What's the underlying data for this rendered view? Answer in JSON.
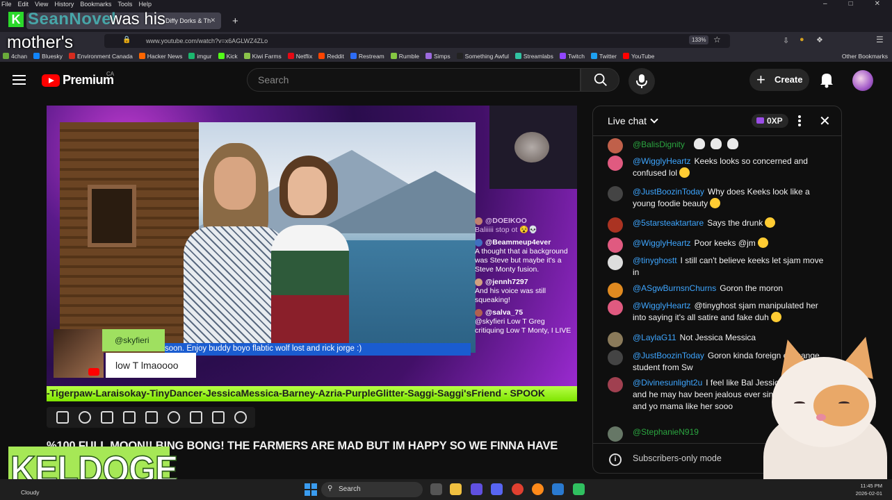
{
  "browser": {
    "menu": [
      "File",
      "Edit",
      "View",
      "History",
      "Bookmarks",
      "Tools",
      "Help"
    ],
    "tab_title": "Diffy Dorks & Th",
    "url": "www.youtube.com/watch?v=x6AGLWZ4ZLo",
    "zoom": "133%",
    "bookmarks": [
      {
        "label": "4chan",
        "color": "#6aaa3a"
      },
      {
        "label": "Bluesky",
        "color": "#1185fe"
      },
      {
        "label": "Environment Canada",
        "color": "#d52b1e"
      },
      {
        "label": "Hacker News",
        "color": "#ff6600"
      },
      {
        "label": "imgur",
        "color": "#1bb76e"
      },
      {
        "label": "Kick",
        "color": "#53fc18"
      },
      {
        "label": "Kiwi Farms",
        "color": "#8bc34a"
      },
      {
        "label": "Netflix",
        "color": "#e50914"
      },
      {
        "label": "Reddit",
        "color": "#ff4500"
      },
      {
        "label": "Restream",
        "color": "#2d6df6"
      },
      {
        "label": "Rumble",
        "color": "#85c742"
      },
      {
        "label": "Simps",
        "color": "#9c6ade"
      },
      {
        "label": "Something Awful",
        "color": "#222222"
      },
      {
        "label": "Streamlabs",
        "color": "#31c3a2"
      },
      {
        "label": "Twitch",
        "color": "#9146ff"
      },
      {
        "label": "Twitter",
        "color": "#1da1f2"
      },
      {
        "label": "YouTube",
        "color": "#ff0000"
      }
    ],
    "other_bookmarks": "Other Bookmarks"
  },
  "overlay": {
    "k_badge": "K",
    "name": "SeanNovel",
    "line1": "was his",
    "line2": "mother's",
    "brand": "KELDOGE"
  },
  "youtube": {
    "logo": "Premium",
    "region": "CA",
    "search_placeholder": "Search",
    "create_label": "Create"
  },
  "video": {
    "tag_name": "@skyfieri",
    "tag_text": "low T lmaoooo",
    "ticker": "soon. Enjoy buddy boyo flabtic wolf lost and rick jorge :)",
    "marquee": "-Tigerpaw-Laraisokay-TinyDancer-JessicaMessica-Barney-Azria-PurpleGlitter-Saggi-Saggi'sFriend - SPOOK",
    "title": "%100 FULL MOON!! BING BONG! THE FARMERS ARE MAD BUT IM HAPPY SO WE FINNA HAVE",
    "chat": [
      {
        "name": "@DOEIKOO",
        "text": "Baliiiii stop ot 😵💀",
        "faded": true
      },
      {
        "name": "@Beammeup4ever",
        "text": "A thought that ai background was Steve but maybe it's a Steve Monty fusion.",
        "faded": false
      },
      {
        "name": "@jennh7297",
        "text": "And his voice was still squeaking!",
        "faded": false
      },
      {
        "name": "@salva_75",
        "text": "@skyfieri Low T Greg critiquing Low T Monty, I LIVE",
        "faded": false
      }
    ]
  },
  "live_chat": {
    "title": "Live chat",
    "xp": "0XP",
    "footer": "Subscribers-only mode",
    "messages": [
      {
        "name": "@BalisDignity",
        "text": "",
        "skulls": 3,
        "color": "#c0604a",
        "green": true
      },
      {
        "name": "@WigglyHeartz",
        "text": "Keeks looks so concerned and confused lol",
        "emoji": true,
        "color": "#e05a80",
        "green": false
      },
      {
        "name": "@JustBoozinToday",
        "text": "Why does Keeks look like a young foodie beauty",
        "emoji": true,
        "color": "#444444",
        "green": false
      },
      {
        "name": "@5starsteaktartare",
        "text": "Says the drunk",
        "emoji": true,
        "color": "#aa3322",
        "green": false
      },
      {
        "name": "@WigglyHeartz",
        "text": "Poor keeks @jm",
        "emoji": true,
        "color": "#e05a80",
        "green": false
      },
      {
        "name": "@tinyghostt",
        "text": "I still can't believe keeks let sjam move in",
        "emoji": false,
        "color": "#dddddd",
        "green": false
      },
      {
        "name": "@ASgwBurnsnChurns",
        "text": "Goron the moron",
        "emoji": false,
        "color": "#e08a20",
        "green": false
      },
      {
        "name": "@WigglyHeartz",
        "text": "@tinyghost sjam manipulated her into saying it's all satire and fake duh",
        "emoji": true,
        "color": "#e05a80",
        "green": false
      },
      {
        "name": "@LaylaG11",
        "text": "Not Jessica Messica",
        "emoji": false,
        "color": "#8a7a5a",
        "green": false
      },
      {
        "name": "@JustBoozinToday",
        "text": "Goron kinda foreign exchange student from Sw",
        "emoji": false,
        "color": "#444444",
        "green": false
      },
      {
        "name": "@Divinesunlight2u",
        "text": "I feel like Bal Jessica messica and he may hav been jealous ever since... she was and yo mama like her sooo",
        "emoji": false,
        "color": "#a04050",
        "green": false
      },
      {
        "name": "@StephanieN919",
        "text": "",
        "emoji": false,
        "color": "#667766",
        "green": true
      }
    ]
  },
  "taskbar": {
    "weather": "Cloudy",
    "search": "Search",
    "time": "11:45 PM",
    "date": "2026-02-01"
  }
}
